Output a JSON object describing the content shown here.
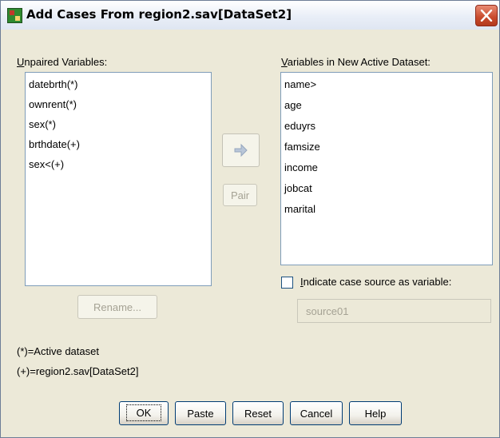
{
  "dialog": {
    "title": "Add Cases From region2.sav[DataSet2]"
  },
  "unpaired": {
    "label": "Unpaired Variables:",
    "items": [
      "datebrth(*)",
      "ownrent(*)",
      "sex(*)",
      "brthdate(+)",
      "sex<(+)"
    ]
  },
  "new_dataset": {
    "label": "Variables in New Active Dataset:",
    "items": [
      "name>",
      "age",
      "eduyrs",
      "famsize",
      "income",
      "jobcat",
      "marital"
    ]
  },
  "buttons": {
    "pair": "Pair",
    "rename": "Rename...",
    "ok": "OK",
    "paste": "Paste",
    "reset": "Reset",
    "cancel": "Cancel",
    "help": "Help"
  },
  "case_source": {
    "label": "Indicate case source as variable:",
    "checked": false,
    "value": "source01"
  },
  "legend": {
    "active": "(*)=Active dataset",
    "other": "(+)=region2.sav[DataSet2]"
  },
  "icons": {
    "title": "spss-add-cases-icon",
    "close": "close-icon",
    "move": "right-arrow-icon"
  },
  "colors": {
    "close_button": "#c84a2c",
    "list_border": "#7f9db9",
    "dialog_bg": "#ece9d8"
  }
}
